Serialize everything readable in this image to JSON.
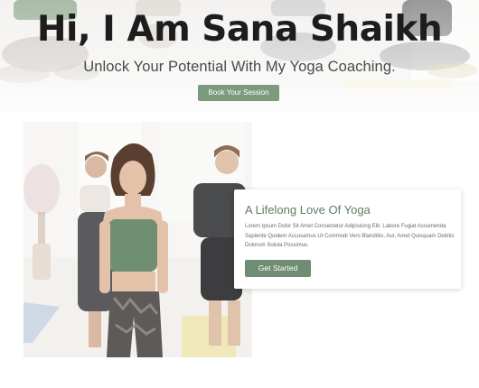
{
  "hero": {
    "title": "Hi, I Am Sana Shaikh",
    "subtitle": "Unlock Your Potential With My Yoga Coaching.",
    "cta_label": "Book Your Session"
  },
  "about": {
    "title": "A Lifelong Love Of Yoga",
    "body": "Lorem Ipsum Dolor Sit Amet Consectetur Adipisicing Elit. Labore Fugiat Assumenda Sapiente Quidem Accusamus Ut Commodi Vero Blanditiis, Aut, Amet Quisquam Debitis Dolorum Soluta Possimus.",
    "cta_label": "Get Started"
  },
  "colors": {
    "accent": "#7c9a7e",
    "title_green": "#5f7d63",
    "heading": "#1d1d1d"
  }
}
